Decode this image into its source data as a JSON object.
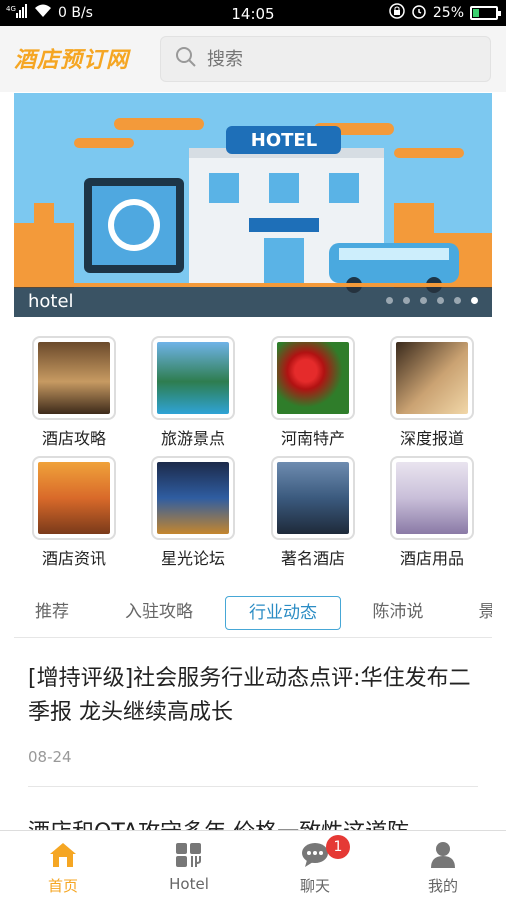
{
  "status_bar": {
    "network": "4G",
    "speed": "0 B/s",
    "time": "14:05",
    "battery": "25%",
    "battery_level": 0.25
  },
  "header": {
    "logo_text": "酒店预订网",
    "search_placeholder": "搜索"
  },
  "banner": {
    "caption": "hotel",
    "sign_text": "HOTEL",
    "slide_count": 6,
    "active_slide": 6
  },
  "categories": [
    {
      "label": "酒店攻略"
    },
    {
      "label": "旅游景点"
    },
    {
      "label": "河南特产"
    },
    {
      "label": "深度报道"
    },
    {
      "label": "酒店资讯"
    },
    {
      "label": "星光论坛"
    },
    {
      "label": "著名酒店"
    },
    {
      "label": "酒店用品"
    }
  ],
  "tabs": [
    {
      "label": "推荐"
    },
    {
      "label": "入驻攻略"
    },
    {
      "label": "行业动态"
    },
    {
      "label": "陈沛说"
    },
    {
      "label": "景"
    }
  ],
  "active_tab": "行业动态",
  "news": [
    {
      "title": "[增持评级]社会服务行业动态点评:华住发布二季报 龙头继续高成长",
      "date": "08-24"
    },
    {
      "title": "酒店和OTA攻守多年 价格一致性这道防"
    }
  ],
  "bottom_nav": [
    {
      "label": "首页"
    },
    {
      "label": "Hotel"
    },
    {
      "label": "聊天",
      "badge": "1"
    },
    {
      "label": "我的"
    }
  ],
  "colors": {
    "accent": "#f5a623",
    "tab_active": "#2b8cc4",
    "badge": "#e53935"
  }
}
